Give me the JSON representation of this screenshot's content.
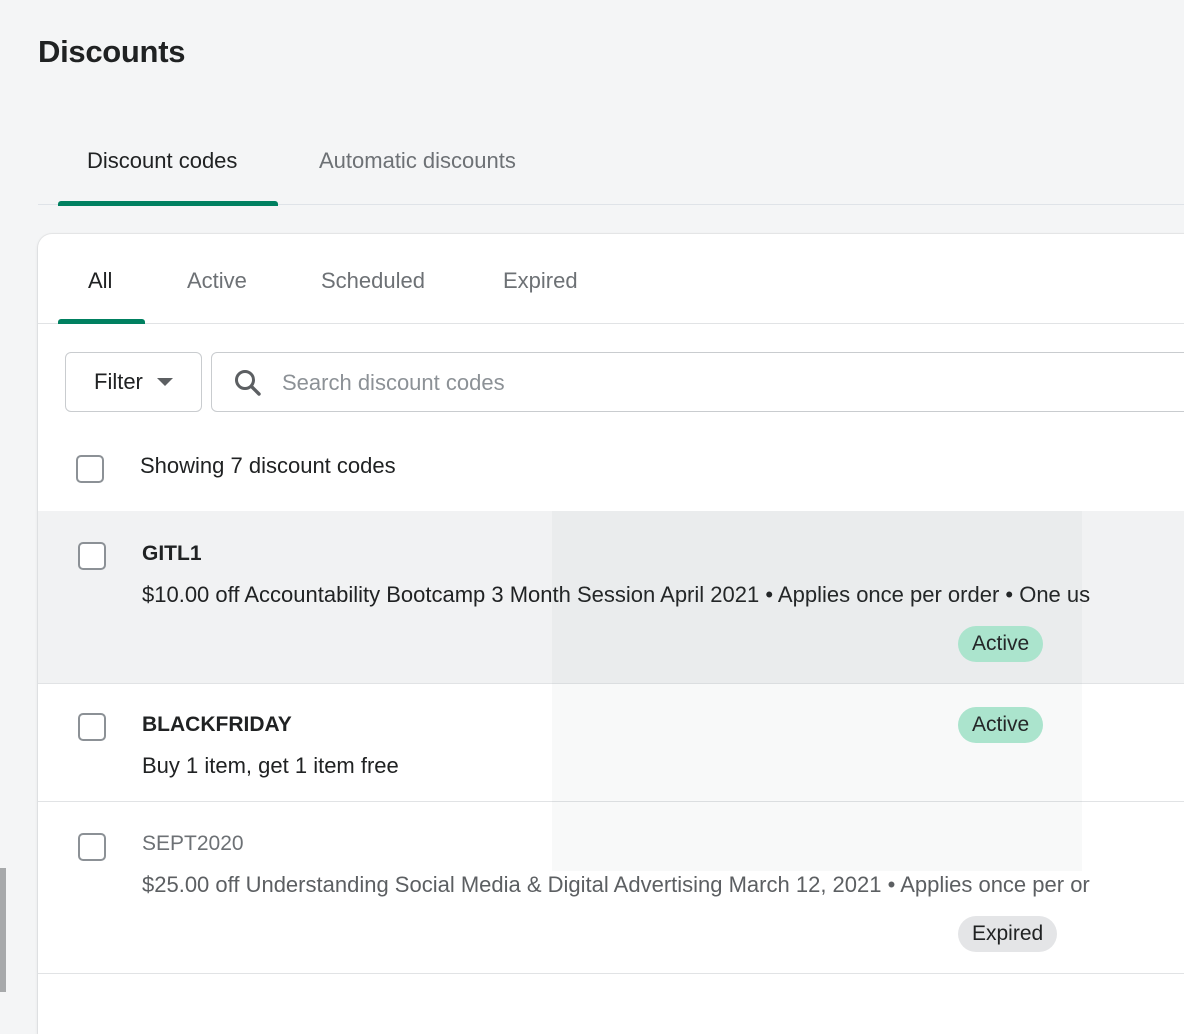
{
  "header": {
    "title": "Discounts"
  },
  "top_tabs": [
    {
      "label": "Discount codes",
      "active": true
    },
    {
      "label": "Automatic discounts",
      "active": false
    }
  ],
  "status_tabs": [
    {
      "label": "All",
      "active": true
    },
    {
      "label": "Active",
      "active": false
    },
    {
      "label": "Scheduled",
      "active": false
    },
    {
      "label": "Expired",
      "active": false
    }
  ],
  "toolbar": {
    "filter_label": "Filter",
    "search_placeholder": "Search discount codes",
    "search_value": ""
  },
  "list": {
    "showing_label": "Showing 7 discount codes",
    "rows": [
      {
        "code": "GITL1",
        "description": "$10.00 off Accountability Bootcamp 3 Month Session April 2021 • Applies once per order • One us",
        "status": "Active"
      },
      {
        "code": "BLACKFRIDAY",
        "description": "Buy 1 item, get 1 item free",
        "status": "Active"
      },
      {
        "code": "SEPT2020",
        "description": "$25.00 off Understanding Social Media & Digital Advertising March 12, 2021 • Applies once per or",
        "status": "Expired"
      }
    ]
  },
  "colors": {
    "accent": "#008060",
    "active_badge": "#aee9d1",
    "expired_badge": "#e4e5e7",
    "background": "#f4f5f6"
  }
}
